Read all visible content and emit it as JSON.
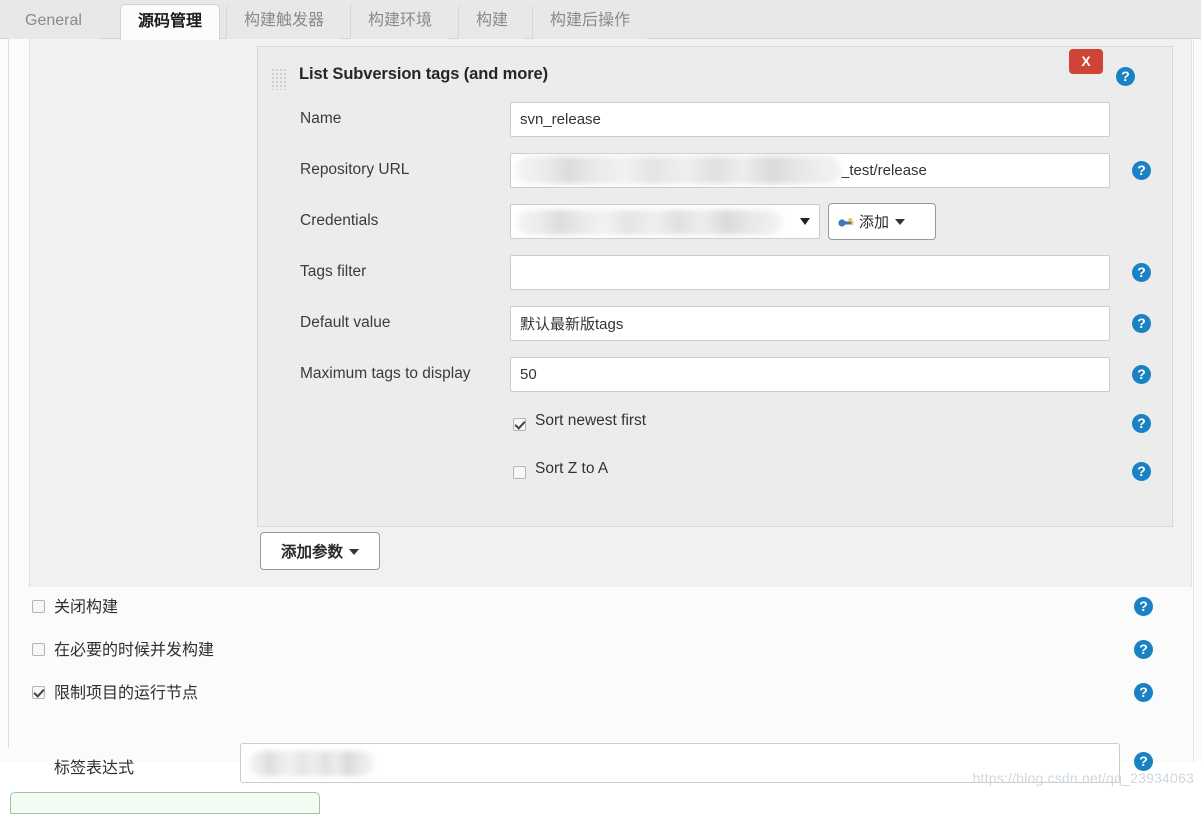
{
  "tabs": [
    {
      "label": "General",
      "active": false
    },
    {
      "label": "源码管理",
      "active": true
    },
    {
      "label": "构建触发器",
      "active": false
    },
    {
      "label": "构建环境",
      "active": false
    },
    {
      "label": "构建",
      "active": false
    },
    {
      "label": "构建后操作",
      "active": false
    }
  ],
  "panel": {
    "title": "List Subversion tags (and more)",
    "close_label": "X",
    "help_glyph": "?",
    "fields": [
      {
        "label": "Name",
        "value": "svn_release",
        "placeholder": "",
        "redacted": false
      },
      {
        "label": "Repository URL",
        "value": "_test/release",
        "placeholder": "",
        "redacted": true
      },
      {
        "label": "Credentials",
        "value": "",
        "placeholder": "",
        "redacted": true
      },
      {
        "label": "Tags filter",
        "value": "",
        "placeholder": "",
        "redacted": false
      },
      {
        "label": "Default value",
        "value": "默认最新版tags",
        "placeholder": "",
        "redacted": false
      },
      {
        "label": "Maximum tags to display",
        "value": "50",
        "placeholder": "",
        "redacted": false
      }
    ],
    "credentials_add_button": "添加",
    "checkboxes": [
      {
        "label": "Sort newest first",
        "checked": true
      },
      {
        "label": "Sort Z to A",
        "checked": false
      }
    ]
  },
  "add_param_button": "添加参数",
  "build_options": [
    {
      "label": "关闭构建",
      "checked": false
    },
    {
      "label": "在必要的时候并发构建",
      "checked": false
    },
    {
      "label": "限制项目的运行节点",
      "checked": true
    }
  ],
  "label_expression": {
    "label": "标签表达式",
    "value": "",
    "redacted": true
  },
  "watermark": "https://blog.csdn.net/qq_23934063",
  "colors": {
    "accent_help": "#1a82c4",
    "danger": "#cf4436",
    "tab_active_bg": "#fcfcfc",
    "panel_bg": "#ececec"
  }
}
